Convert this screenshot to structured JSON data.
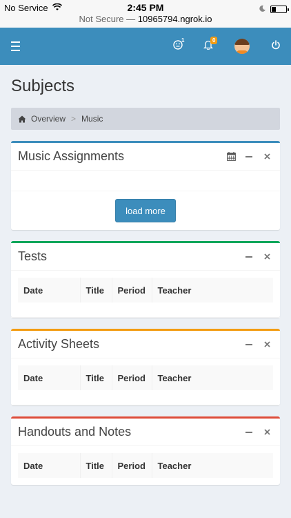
{
  "status_bar": {
    "carrier": "No Service",
    "time": "2:45 PM",
    "url_prefix": "Not Secure —",
    "url_host": "10965794.ngrok.io"
  },
  "topbar": {
    "accent": "#3c8dbc",
    "notification_count_smiley": "1",
    "notification_count_bell": "0",
    "icons": [
      "menu-icon",
      "smiley-icon",
      "bell-icon",
      "avatar",
      "power-icon"
    ]
  },
  "page": {
    "title": "Subjects",
    "breadcrumb": {
      "home": "Overview",
      "separator": ">",
      "current": "Music"
    }
  },
  "assignments_box": {
    "title": "Music Assignments",
    "load_more_label": "load more"
  },
  "tests_box": {
    "title": "Tests",
    "columns": [
      "Date",
      "Title",
      "Period",
      "Teacher"
    ]
  },
  "activity_box": {
    "title": "Activity Sheets",
    "columns": [
      "Date",
      "Title",
      "Period",
      "Teacher"
    ]
  },
  "handouts_box": {
    "title": "Handouts and Notes",
    "columns": [
      "Date",
      "Title",
      "Period",
      "Teacher"
    ]
  }
}
